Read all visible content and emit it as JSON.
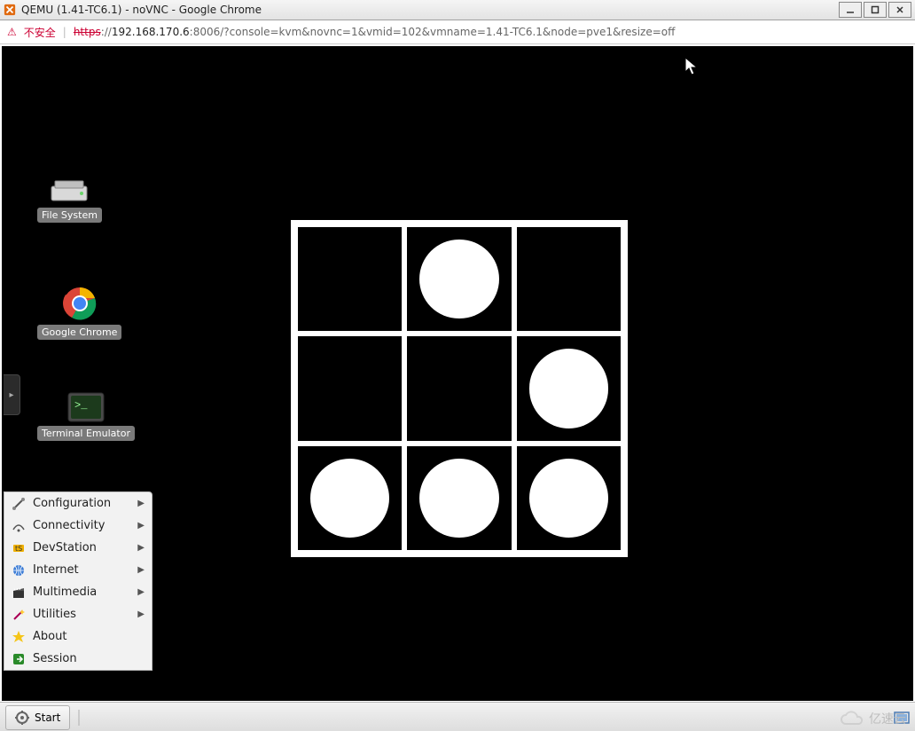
{
  "window": {
    "title": "QEMU (1.41-TC6.1) - noVNC - Google Chrome",
    "min_tip": "Minimize",
    "max_tip": "Maximize",
    "close_tip": "Close"
  },
  "addressbar": {
    "warn_label": "不安全",
    "scheme": "https",
    "rest": "://",
    "host": "192.168.170.6",
    "port_path": ":8006/?console=kvm&novnc=1&vmid=102&vmname=1.41-TC6.1&node=pve1&resize=off"
  },
  "novnc_tab": {
    "tip": "expand-controls"
  },
  "desktop_icons": {
    "file_system": "File System",
    "google_chrome": "Google Chrome",
    "terminal_emulator": "Terminal Emulator"
  },
  "throbber": {
    "dots": [
      [
        false,
        true,
        false
      ],
      [
        false,
        false,
        true
      ],
      [
        true,
        true,
        true
      ]
    ]
  },
  "start_menu": {
    "items": [
      {
        "label": "Configuration",
        "icon": "tools-icon",
        "submenu": true
      },
      {
        "label": "Connectivity",
        "icon": "network-icon",
        "submenu": true
      },
      {
        "label": "DevStation",
        "icon": "devstation-icon",
        "submenu": true
      },
      {
        "label": "Internet",
        "icon": "globe-icon",
        "submenu": true
      },
      {
        "label": "Multimedia",
        "icon": "clapper-icon",
        "submenu": true
      },
      {
        "label": "Utilities",
        "icon": "wand-icon",
        "submenu": true
      },
      {
        "label": "About",
        "icon": "star-icon",
        "submenu": false
      },
      {
        "label": "Session",
        "icon": "exit-icon",
        "submenu": false
      }
    ]
  },
  "taskbar": {
    "start_label": "Start"
  },
  "watermark": {
    "text": "亿速云"
  }
}
